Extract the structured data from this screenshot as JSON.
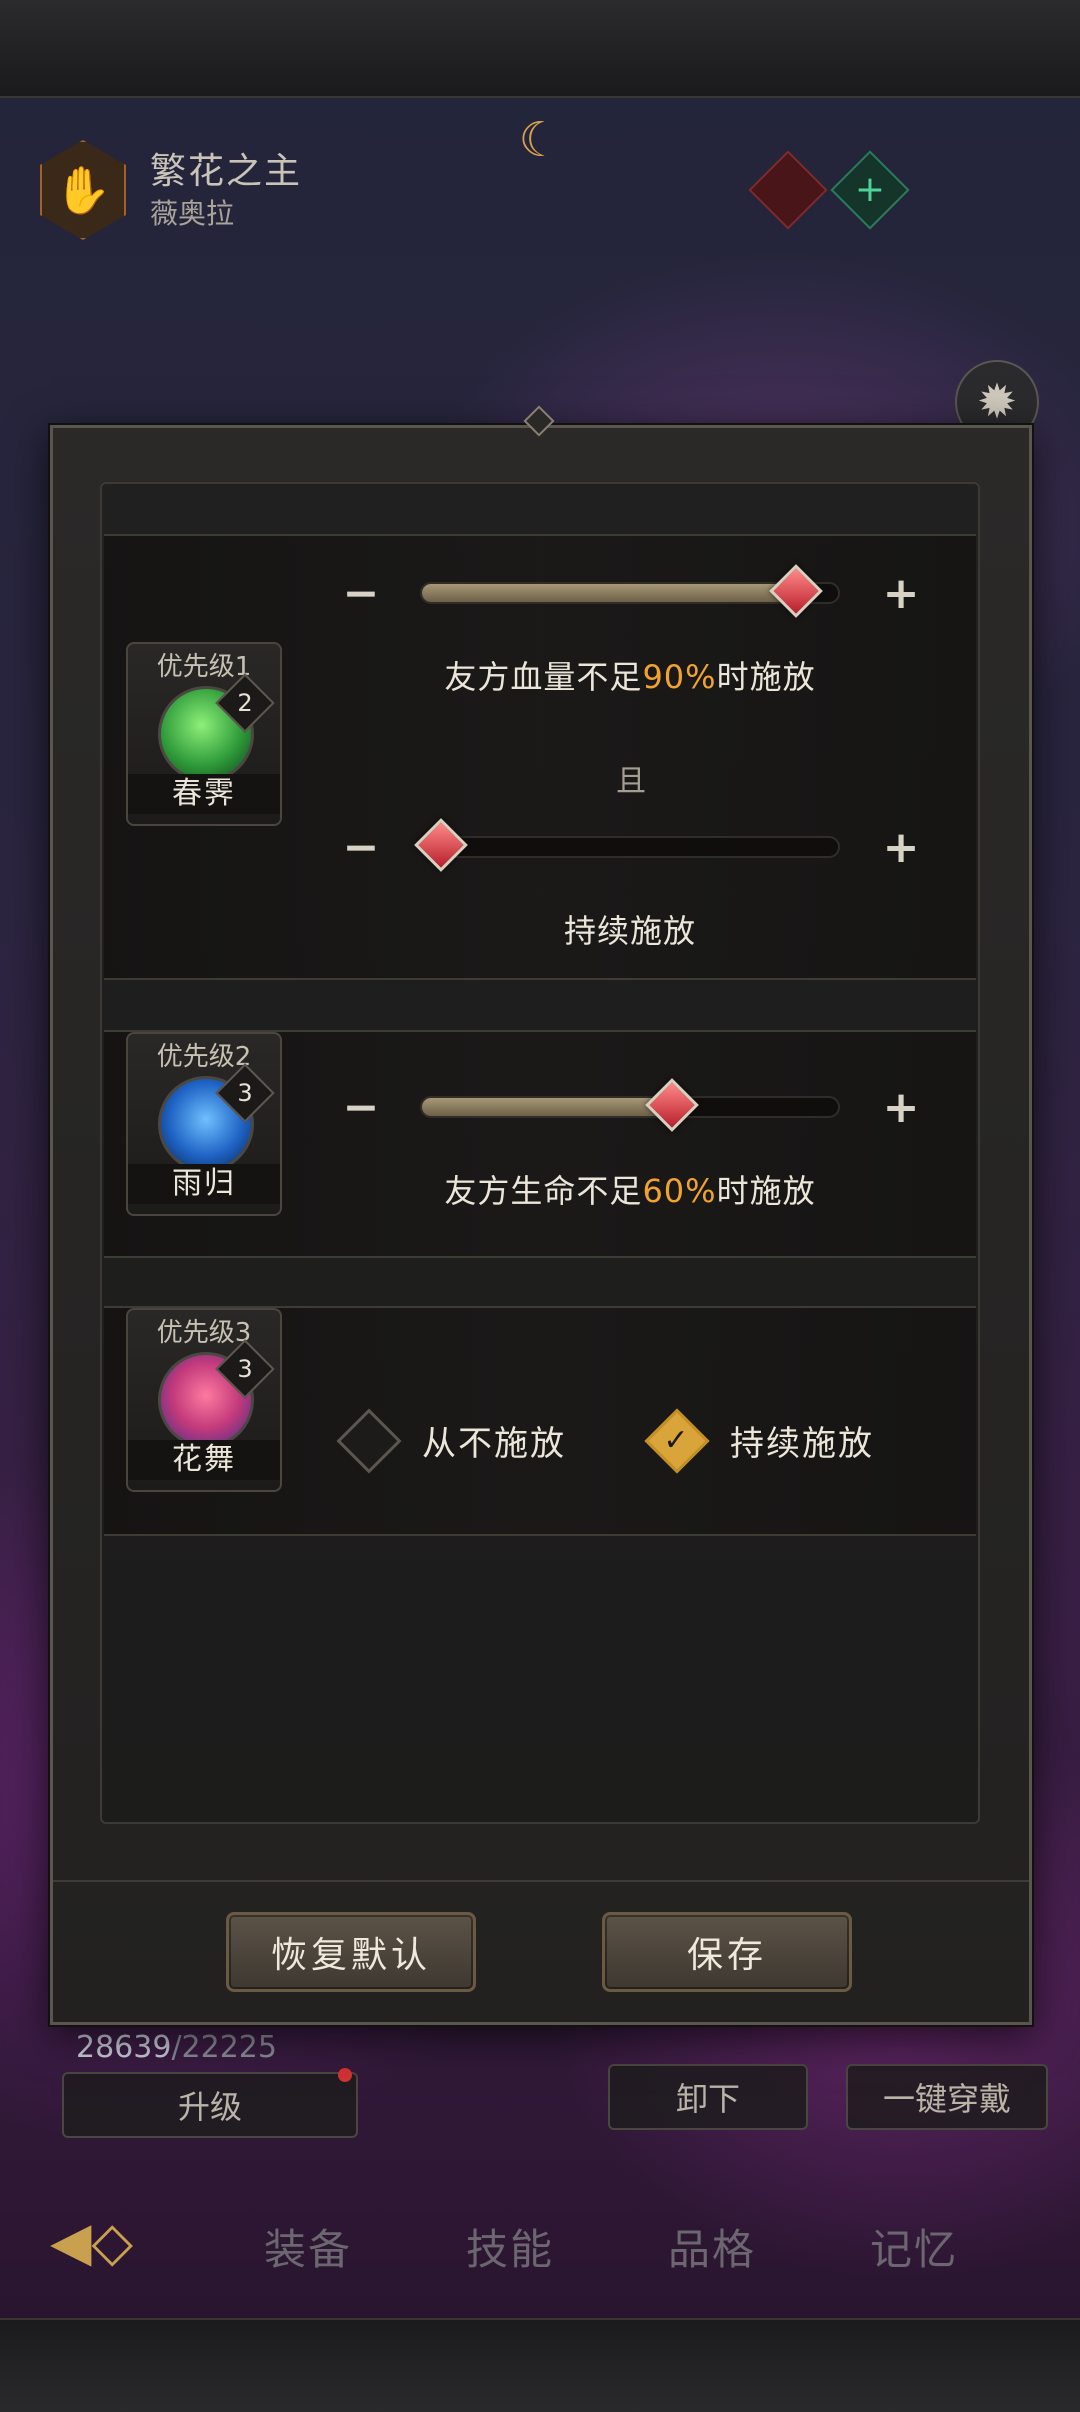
{
  "hero": {
    "title": "繁花之主",
    "subtitle": "薇奥拉"
  },
  "modal": {
    "skills": [
      {
        "priority": "优先级1",
        "name": "春霁",
        "level": "2",
        "conditions": [
          {
            "prefix": "友方血量不足",
            "percent": "90%",
            "suffix": "时施放",
            "slider_value": 0.9
          },
          {
            "text": "持续施放",
            "slider_value": 0.0
          }
        ],
        "joiner": "且"
      },
      {
        "priority": "优先级2",
        "name": "雨归",
        "level": "3",
        "conditions": [
          {
            "prefix": "友方生命不足",
            "percent": "60%",
            "suffix": "时施放",
            "slider_value": 0.6
          }
        ]
      },
      {
        "priority": "优先级3",
        "name": "花舞",
        "level": "3",
        "options": [
          {
            "label": "从不施放",
            "checked": false
          },
          {
            "label": "持续施放",
            "checked": true
          }
        ]
      }
    ],
    "minus_symbol": "−",
    "plus_symbol": "+",
    "buttons": {
      "reset": "恢复默认",
      "save": "保存"
    }
  },
  "background": {
    "resource": {
      "current": "28639",
      "separator": "/",
      "max": "22225"
    },
    "upgrade": "升级",
    "unequip": "卸下",
    "equip_all": "一键穿戴",
    "tabs": [
      "装备",
      "技能",
      "品格",
      "记忆"
    ]
  },
  "icons": {
    "hero_emblem": "hand-emblem-icon",
    "crest": "crescent-crest-icon",
    "settings": "gear-icon",
    "back": "back-arrow-icon",
    "minus": "minus-icon",
    "plus": "plus-icon",
    "check": "check-icon"
  },
  "colors": {
    "accent_orange": "#f0a32e",
    "knob_red": "#b81f2a",
    "checked_gold": "#d9a53a"
  }
}
